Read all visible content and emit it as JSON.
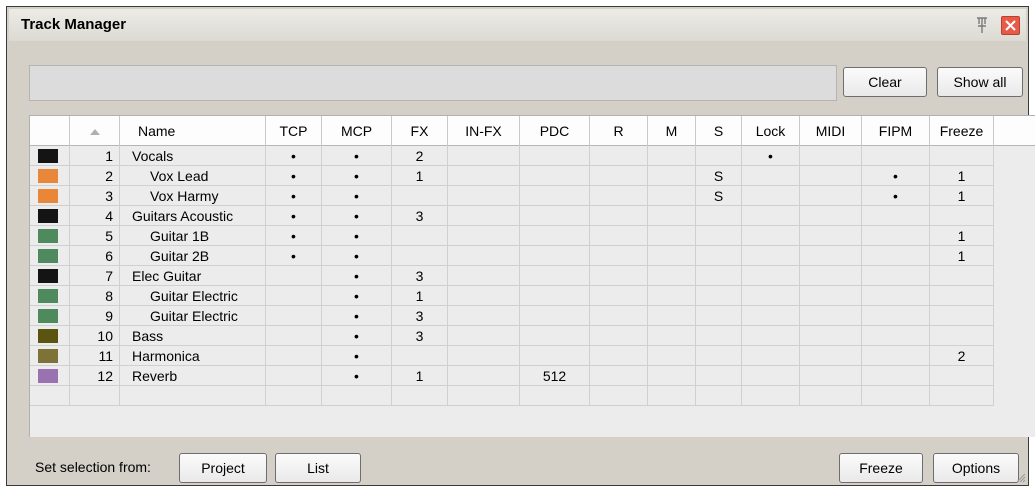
{
  "window": {
    "title": "Track Manager"
  },
  "toolbar": {
    "clear_label": "Clear",
    "show_all_label": "Show all"
  },
  "columns": [
    "",
    "",
    "Name",
    "TCP",
    "MCP",
    "FX",
    "IN-FX",
    "PDC",
    "R",
    "M",
    "S",
    "Lock",
    "MIDI",
    "FIPM",
    "Freeze"
  ],
  "tracks": [
    {
      "color": "#141414",
      "num": "1",
      "name": "Vocals",
      "child": false,
      "tcp": "•",
      "mcp": "•",
      "fx": "2",
      "infx": "",
      "pdc": "",
      "r": "",
      "m": "",
      "s": "",
      "lock": "•",
      "midi": "",
      "fipm": "",
      "freeze": ""
    },
    {
      "color": "#e8863a",
      "num": "2",
      "name": "Vox Lead",
      "child": true,
      "tcp": "•",
      "mcp": "•",
      "fx": "1",
      "infx": "",
      "pdc": "",
      "r": "",
      "m": "",
      "s": "S",
      "lock": "",
      "midi": "",
      "fipm": "•",
      "freeze": "1"
    },
    {
      "color": "#e8863a",
      "num": "3",
      "name": "Vox Harmy",
      "child": true,
      "tcp": "•",
      "mcp": "•",
      "fx": "",
      "infx": "",
      "pdc": "",
      "r": "",
      "m": "",
      "s": "S",
      "lock": "",
      "midi": "",
      "fipm": "•",
      "freeze": "1"
    },
    {
      "color": "#141414",
      "num": "4",
      "name": "Guitars Acoustic",
      "child": false,
      "tcp": "•",
      "mcp": "•",
      "fx": "3",
      "infx": "",
      "pdc": "",
      "r": "",
      "m": "",
      "s": "",
      "lock": "",
      "midi": "",
      "fipm": "",
      "freeze": ""
    },
    {
      "color": "#4f8a5f",
      "num": "5",
      "name": "Guitar 1B",
      "child": true,
      "tcp": "•",
      "mcp": "•",
      "fx": "",
      "infx": "",
      "pdc": "",
      "r": "",
      "m": "",
      "s": "",
      "lock": "",
      "midi": "",
      "fipm": "",
      "freeze": "1"
    },
    {
      "color": "#4f8a5f",
      "num": "6",
      "name": "Guitar 2B",
      "child": true,
      "tcp": "•",
      "mcp": "•",
      "fx": "",
      "infx": "",
      "pdc": "",
      "r": "",
      "m": "",
      "s": "",
      "lock": "",
      "midi": "",
      "fipm": "",
      "freeze": "1"
    },
    {
      "color": "#141414",
      "num": "7",
      "name": "Elec Guitar",
      "child": false,
      "tcp": "",
      "mcp": "•",
      "fx": "3",
      "infx": "",
      "pdc": "",
      "r": "",
      "m": "",
      "s": "",
      "lock": "",
      "midi": "",
      "fipm": "",
      "freeze": ""
    },
    {
      "color": "#4f8a5f",
      "num": "8",
      "name": "Guitar Electric",
      "child": true,
      "tcp": "",
      "mcp": "•",
      "fx": "1",
      "infx": "",
      "pdc": "",
      "r": "",
      "m": "",
      "s": "",
      "lock": "",
      "midi": "",
      "fipm": "",
      "freeze": ""
    },
    {
      "color": "#4f8a5f",
      "num": "9",
      "name": "Guitar Electric",
      "child": true,
      "tcp": "",
      "mcp": "•",
      "fx": "3",
      "infx": "",
      "pdc": "",
      "r": "",
      "m": "",
      "s": "",
      "lock": "",
      "midi": "",
      "fipm": "",
      "freeze": ""
    },
    {
      "color": "#5a5410",
      "num": "10",
      "name": "Bass",
      "child": false,
      "tcp": "",
      "mcp": "•",
      "fx": "3",
      "infx": "",
      "pdc": "",
      "r": "",
      "m": "",
      "s": "",
      "lock": "",
      "midi": "",
      "fipm": "",
      "freeze": ""
    },
    {
      "color": "#7d7238",
      "num": "11",
      "name": "Harmonica",
      "child": false,
      "tcp": "",
      "mcp": "•",
      "fx": "",
      "infx": "",
      "pdc": "",
      "r": "",
      "m": "",
      "s": "",
      "lock": "",
      "midi": "",
      "fipm": "",
      "freeze": "2"
    },
    {
      "color": "#9a72b0",
      "num": "12",
      "name": "Reverb",
      "child": false,
      "tcp": "",
      "mcp": "•",
      "fx": "1",
      "infx": "",
      "pdc": "512",
      "r": "",
      "m": "",
      "s": "",
      "lock": "",
      "midi": "",
      "fipm": "",
      "freeze": ""
    }
  ],
  "footer": {
    "selection_label": "Set selection from:",
    "project_label": "Project",
    "list_label": "List",
    "freeze_label": "Freeze",
    "options_label": "Options"
  },
  "icons": {
    "pin": "pin-icon",
    "close": "close-icon",
    "sort": "sort-ascending-icon"
  }
}
